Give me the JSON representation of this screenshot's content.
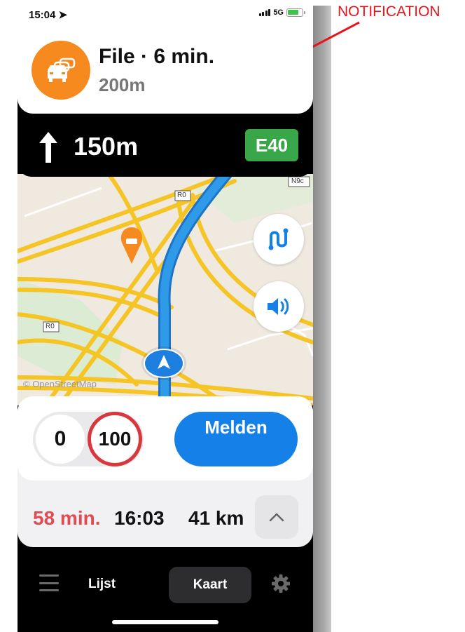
{
  "status_bar": {
    "time": "15:04",
    "network": "5G"
  },
  "notification": {
    "title": "File · 6 min.",
    "distance": "200m",
    "icon": "traffic-jam-icon",
    "accent": "#f78a1f"
  },
  "direction": {
    "distance": "150m",
    "road": "E40",
    "road_color": "#3aa64a",
    "icon": "arrow-up-icon"
  },
  "map": {
    "road_labels": [
      "R0",
      "N9c",
      "R0"
    ],
    "attribution": "© OpenStreetMap",
    "buttons": {
      "route_icon": "route-icon",
      "sound_icon": "speaker-icon"
    },
    "route_color": "#2f9be8"
  },
  "speed": {
    "current": "0",
    "limit": "100"
  },
  "report_button": {
    "label": "Melden"
  },
  "trip": {
    "duration": "58 min.",
    "arrival": "16:03",
    "distance": "41 km"
  },
  "nav": {
    "list_tab": "Lijst",
    "map_tab": "Kaart"
  },
  "annotation": {
    "label": "NOTIFICATION",
    "color": "#e8141c"
  }
}
